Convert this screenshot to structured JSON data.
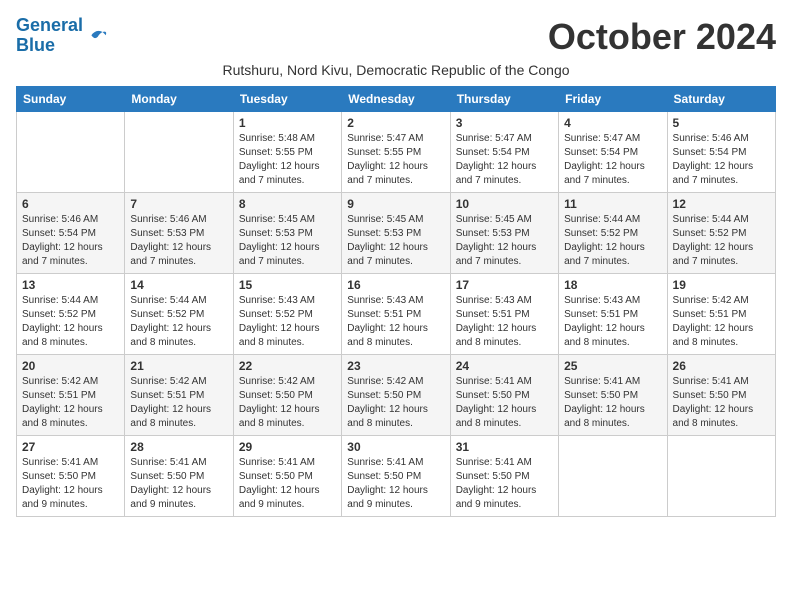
{
  "logo": {
    "line1": "General",
    "line2": "Blue"
  },
  "title": "October 2024",
  "subtitle": "Rutshuru, Nord Kivu, Democratic Republic of the Congo",
  "days_of_week": [
    "Sunday",
    "Monday",
    "Tuesday",
    "Wednesday",
    "Thursday",
    "Friday",
    "Saturday"
  ],
  "weeks": [
    [
      {
        "day": "",
        "info": ""
      },
      {
        "day": "",
        "info": ""
      },
      {
        "day": "1",
        "info": "Sunrise: 5:48 AM\nSunset: 5:55 PM\nDaylight: 12 hours and 7 minutes."
      },
      {
        "day": "2",
        "info": "Sunrise: 5:47 AM\nSunset: 5:55 PM\nDaylight: 12 hours and 7 minutes."
      },
      {
        "day": "3",
        "info": "Sunrise: 5:47 AM\nSunset: 5:54 PM\nDaylight: 12 hours and 7 minutes."
      },
      {
        "day": "4",
        "info": "Sunrise: 5:47 AM\nSunset: 5:54 PM\nDaylight: 12 hours and 7 minutes."
      },
      {
        "day": "5",
        "info": "Sunrise: 5:46 AM\nSunset: 5:54 PM\nDaylight: 12 hours and 7 minutes."
      }
    ],
    [
      {
        "day": "6",
        "info": "Sunrise: 5:46 AM\nSunset: 5:54 PM\nDaylight: 12 hours and 7 minutes."
      },
      {
        "day": "7",
        "info": "Sunrise: 5:46 AM\nSunset: 5:53 PM\nDaylight: 12 hours and 7 minutes."
      },
      {
        "day": "8",
        "info": "Sunrise: 5:45 AM\nSunset: 5:53 PM\nDaylight: 12 hours and 7 minutes."
      },
      {
        "day": "9",
        "info": "Sunrise: 5:45 AM\nSunset: 5:53 PM\nDaylight: 12 hours and 7 minutes."
      },
      {
        "day": "10",
        "info": "Sunrise: 5:45 AM\nSunset: 5:53 PM\nDaylight: 12 hours and 7 minutes."
      },
      {
        "day": "11",
        "info": "Sunrise: 5:44 AM\nSunset: 5:52 PM\nDaylight: 12 hours and 7 minutes."
      },
      {
        "day": "12",
        "info": "Sunrise: 5:44 AM\nSunset: 5:52 PM\nDaylight: 12 hours and 7 minutes."
      }
    ],
    [
      {
        "day": "13",
        "info": "Sunrise: 5:44 AM\nSunset: 5:52 PM\nDaylight: 12 hours and 8 minutes."
      },
      {
        "day": "14",
        "info": "Sunrise: 5:44 AM\nSunset: 5:52 PM\nDaylight: 12 hours and 8 minutes."
      },
      {
        "day": "15",
        "info": "Sunrise: 5:43 AM\nSunset: 5:52 PM\nDaylight: 12 hours and 8 minutes."
      },
      {
        "day": "16",
        "info": "Sunrise: 5:43 AM\nSunset: 5:51 PM\nDaylight: 12 hours and 8 minutes."
      },
      {
        "day": "17",
        "info": "Sunrise: 5:43 AM\nSunset: 5:51 PM\nDaylight: 12 hours and 8 minutes."
      },
      {
        "day": "18",
        "info": "Sunrise: 5:43 AM\nSunset: 5:51 PM\nDaylight: 12 hours and 8 minutes."
      },
      {
        "day": "19",
        "info": "Sunrise: 5:42 AM\nSunset: 5:51 PM\nDaylight: 12 hours and 8 minutes."
      }
    ],
    [
      {
        "day": "20",
        "info": "Sunrise: 5:42 AM\nSunset: 5:51 PM\nDaylight: 12 hours and 8 minutes."
      },
      {
        "day": "21",
        "info": "Sunrise: 5:42 AM\nSunset: 5:51 PM\nDaylight: 12 hours and 8 minutes."
      },
      {
        "day": "22",
        "info": "Sunrise: 5:42 AM\nSunset: 5:50 PM\nDaylight: 12 hours and 8 minutes."
      },
      {
        "day": "23",
        "info": "Sunrise: 5:42 AM\nSunset: 5:50 PM\nDaylight: 12 hours and 8 minutes."
      },
      {
        "day": "24",
        "info": "Sunrise: 5:41 AM\nSunset: 5:50 PM\nDaylight: 12 hours and 8 minutes."
      },
      {
        "day": "25",
        "info": "Sunrise: 5:41 AM\nSunset: 5:50 PM\nDaylight: 12 hours and 8 minutes."
      },
      {
        "day": "26",
        "info": "Sunrise: 5:41 AM\nSunset: 5:50 PM\nDaylight: 12 hours and 8 minutes."
      }
    ],
    [
      {
        "day": "27",
        "info": "Sunrise: 5:41 AM\nSunset: 5:50 PM\nDaylight: 12 hours and 9 minutes."
      },
      {
        "day": "28",
        "info": "Sunrise: 5:41 AM\nSunset: 5:50 PM\nDaylight: 12 hours and 9 minutes."
      },
      {
        "day": "29",
        "info": "Sunrise: 5:41 AM\nSunset: 5:50 PM\nDaylight: 12 hours and 9 minutes."
      },
      {
        "day": "30",
        "info": "Sunrise: 5:41 AM\nSunset: 5:50 PM\nDaylight: 12 hours and 9 minutes."
      },
      {
        "day": "31",
        "info": "Sunrise: 5:41 AM\nSunset: 5:50 PM\nDaylight: 12 hours and 9 minutes."
      },
      {
        "day": "",
        "info": ""
      },
      {
        "day": "",
        "info": ""
      }
    ]
  ]
}
